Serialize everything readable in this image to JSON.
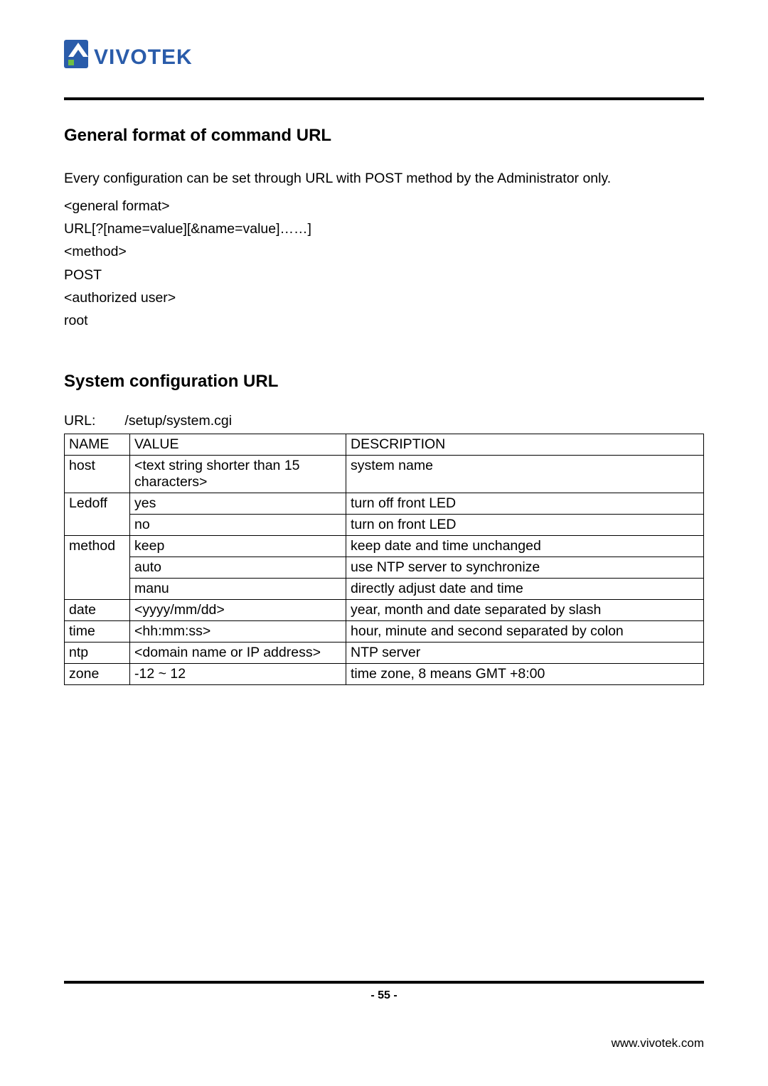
{
  "logo_text": "VIVOTEK",
  "section1": {
    "title": "General format of command URL",
    "intro": "Every configuration can be set through URL with POST method by the Administrator only.",
    "lines": [
      "<general format>",
      "URL[?[name=value][&name=value]……]",
      "<method>",
      "POST",
      "<authorized user>",
      "root"
    ]
  },
  "section2": {
    "title": "System configuration URL",
    "url_label": "URL:",
    "url_value": "/setup/system.cgi",
    "headers": {
      "name": "NAME",
      "value": "VALUE",
      "desc": "DESCRIPTION"
    },
    "rows": [
      {
        "name": "host",
        "values": [
          "<text string shorter than 15 characters>"
        ],
        "descs": [
          "system name"
        ]
      },
      {
        "name": "Ledoff",
        "values": [
          "yes",
          "no"
        ],
        "descs": [
          "turn off front LED",
          "turn on front LED"
        ]
      },
      {
        "name": "method",
        "values": [
          "keep",
          "auto",
          "manu"
        ],
        "descs": [
          "keep date and time unchanged",
          "use NTP server to synchronize",
          "directly adjust date and time"
        ]
      },
      {
        "name": "date",
        "values": [
          "<yyyy/mm/dd>"
        ],
        "descs": [
          "year, month and date separated by slash"
        ]
      },
      {
        "name": "time",
        "values": [
          "<hh:mm:ss>"
        ],
        "descs": [
          "hour, minute and second separated by colon"
        ]
      },
      {
        "name": "ntp",
        "values": [
          "<domain name or IP address>"
        ],
        "descs": [
          "NTP server"
        ]
      },
      {
        "name": "zone",
        "values": [
          "-12 ~ 12"
        ],
        "descs": [
          "time zone, 8 means GMT +8:00"
        ]
      }
    ]
  },
  "footer": {
    "page_prefix": "- ",
    "page_num": "55",
    "page_suffix": " -",
    "site": "www.vivotek.com"
  }
}
